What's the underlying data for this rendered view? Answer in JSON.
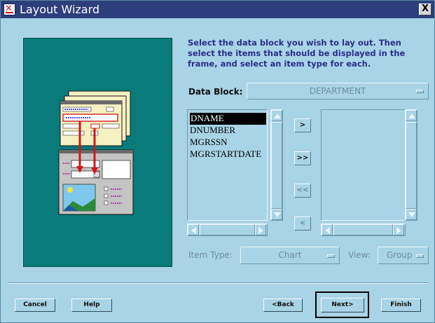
{
  "window": {
    "title": "Layout Wizard",
    "close_glyph": "X",
    "icon": "oracle-x-icon"
  },
  "instructions": "Select the data block you wish to lay out. Then select the items that should be displayed in the frame, and select an item type for each.",
  "data_block": {
    "label": "Data Block:",
    "value": "DEPARTMENT"
  },
  "available_items": [
    "DNAME",
    "DNUMBER",
    "MGRSSN",
    "MGRSTARTDATE"
  ],
  "selected_index": 0,
  "move_buttons": {
    "move_one": ">",
    "move_all": ">>",
    "remove_all": "<<",
    "remove_one": "<"
  },
  "item_type": {
    "label": "Item Type:",
    "value": "Chart"
  },
  "view": {
    "label": "View:",
    "value": "Group"
  },
  "buttons": {
    "cancel": "Cancel",
    "help": "Help",
    "back": "<Back",
    "next": "Next>",
    "finish": "Finish"
  },
  "colors": {
    "background": "#a9d3e6",
    "titlebar": "#2c3f7c",
    "illustration_bg": "#0a7b7b",
    "instruction_text": "#2b2f88"
  }
}
